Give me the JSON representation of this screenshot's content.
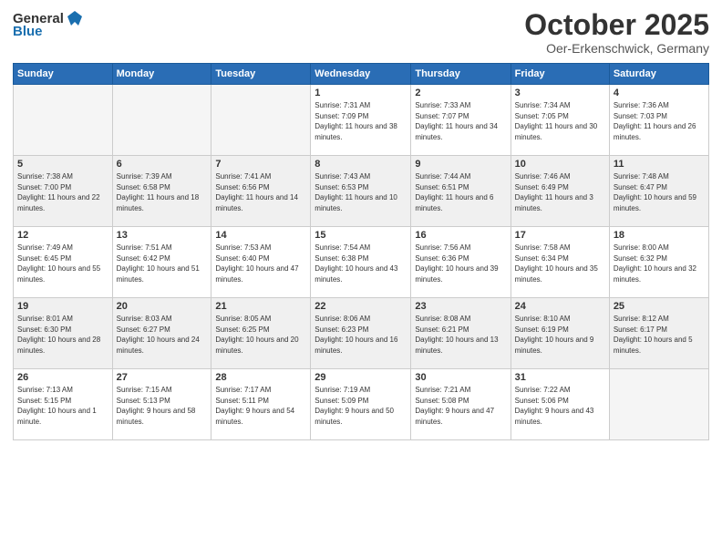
{
  "header": {
    "logo_general": "General",
    "logo_blue": "Blue",
    "month_title": "October 2025",
    "location": "Oer-Erkenschwick, Germany"
  },
  "days_of_week": [
    "Sunday",
    "Monday",
    "Tuesday",
    "Wednesday",
    "Thursday",
    "Friday",
    "Saturday"
  ],
  "weeks": [
    {
      "shaded": false,
      "days": [
        {
          "num": "",
          "sunrise": "",
          "sunset": "",
          "daylight": ""
        },
        {
          "num": "",
          "sunrise": "",
          "sunset": "",
          "daylight": ""
        },
        {
          "num": "",
          "sunrise": "",
          "sunset": "",
          "daylight": ""
        },
        {
          "num": "1",
          "sunrise": "Sunrise: 7:31 AM",
          "sunset": "Sunset: 7:09 PM",
          "daylight": "Daylight: 11 hours and 38 minutes."
        },
        {
          "num": "2",
          "sunrise": "Sunrise: 7:33 AM",
          "sunset": "Sunset: 7:07 PM",
          "daylight": "Daylight: 11 hours and 34 minutes."
        },
        {
          "num": "3",
          "sunrise": "Sunrise: 7:34 AM",
          "sunset": "Sunset: 7:05 PM",
          "daylight": "Daylight: 11 hours and 30 minutes."
        },
        {
          "num": "4",
          "sunrise": "Sunrise: 7:36 AM",
          "sunset": "Sunset: 7:03 PM",
          "daylight": "Daylight: 11 hours and 26 minutes."
        }
      ]
    },
    {
      "shaded": true,
      "days": [
        {
          "num": "5",
          "sunrise": "Sunrise: 7:38 AM",
          "sunset": "Sunset: 7:00 PM",
          "daylight": "Daylight: 11 hours and 22 minutes."
        },
        {
          "num": "6",
          "sunrise": "Sunrise: 7:39 AM",
          "sunset": "Sunset: 6:58 PM",
          "daylight": "Daylight: 11 hours and 18 minutes."
        },
        {
          "num": "7",
          "sunrise": "Sunrise: 7:41 AM",
          "sunset": "Sunset: 6:56 PM",
          "daylight": "Daylight: 11 hours and 14 minutes."
        },
        {
          "num": "8",
          "sunrise": "Sunrise: 7:43 AM",
          "sunset": "Sunset: 6:53 PM",
          "daylight": "Daylight: 11 hours and 10 minutes."
        },
        {
          "num": "9",
          "sunrise": "Sunrise: 7:44 AM",
          "sunset": "Sunset: 6:51 PM",
          "daylight": "Daylight: 11 hours and 6 minutes."
        },
        {
          "num": "10",
          "sunrise": "Sunrise: 7:46 AM",
          "sunset": "Sunset: 6:49 PM",
          "daylight": "Daylight: 11 hours and 3 minutes."
        },
        {
          "num": "11",
          "sunrise": "Sunrise: 7:48 AM",
          "sunset": "Sunset: 6:47 PM",
          "daylight": "Daylight: 10 hours and 59 minutes."
        }
      ]
    },
    {
      "shaded": false,
      "days": [
        {
          "num": "12",
          "sunrise": "Sunrise: 7:49 AM",
          "sunset": "Sunset: 6:45 PM",
          "daylight": "Daylight: 10 hours and 55 minutes."
        },
        {
          "num": "13",
          "sunrise": "Sunrise: 7:51 AM",
          "sunset": "Sunset: 6:42 PM",
          "daylight": "Daylight: 10 hours and 51 minutes."
        },
        {
          "num": "14",
          "sunrise": "Sunrise: 7:53 AM",
          "sunset": "Sunset: 6:40 PM",
          "daylight": "Daylight: 10 hours and 47 minutes."
        },
        {
          "num": "15",
          "sunrise": "Sunrise: 7:54 AM",
          "sunset": "Sunset: 6:38 PM",
          "daylight": "Daylight: 10 hours and 43 minutes."
        },
        {
          "num": "16",
          "sunrise": "Sunrise: 7:56 AM",
          "sunset": "Sunset: 6:36 PM",
          "daylight": "Daylight: 10 hours and 39 minutes."
        },
        {
          "num": "17",
          "sunrise": "Sunrise: 7:58 AM",
          "sunset": "Sunset: 6:34 PM",
          "daylight": "Daylight: 10 hours and 35 minutes."
        },
        {
          "num": "18",
          "sunrise": "Sunrise: 8:00 AM",
          "sunset": "Sunset: 6:32 PM",
          "daylight": "Daylight: 10 hours and 32 minutes."
        }
      ]
    },
    {
      "shaded": true,
      "days": [
        {
          "num": "19",
          "sunrise": "Sunrise: 8:01 AM",
          "sunset": "Sunset: 6:30 PM",
          "daylight": "Daylight: 10 hours and 28 minutes."
        },
        {
          "num": "20",
          "sunrise": "Sunrise: 8:03 AM",
          "sunset": "Sunset: 6:27 PM",
          "daylight": "Daylight: 10 hours and 24 minutes."
        },
        {
          "num": "21",
          "sunrise": "Sunrise: 8:05 AM",
          "sunset": "Sunset: 6:25 PM",
          "daylight": "Daylight: 10 hours and 20 minutes."
        },
        {
          "num": "22",
          "sunrise": "Sunrise: 8:06 AM",
          "sunset": "Sunset: 6:23 PM",
          "daylight": "Daylight: 10 hours and 16 minutes."
        },
        {
          "num": "23",
          "sunrise": "Sunrise: 8:08 AM",
          "sunset": "Sunset: 6:21 PM",
          "daylight": "Daylight: 10 hours and 13 minutes."
        },
        {
          "num": "24",
          "sunrise": "Sunrise: 8:10 AM",
          "sunset": "Sunset: 6:19 PM",
          "daylight": "Daylight: 10 hours and 9 minutes."
        },
        {
          "num": "25",
          "sunrise": "Sunrise: 8:12 AM",
          "sunset": "Sunset: 6:17 PM",
          "daylight": "Daylight: 10 hours and 5 minutes."
        }
      ]
    },
    {
      "shaded": false,
      "days": [
        {
          "num": "26",
          "sunrise": "Sunrise: 7:13 AM",
          "sunset": "Sunset: 5:15 PM",
          "daylight": "Daylight: 10 hours and 1 minute."
        },
        {
          "num": "27",
          "sunrise": "Sunrise: 7:15 AM",
          "sunset": "Sunset: 5:13 PM",
          "daylight": "Daylight: 9 hours and 58 minutes."
        },
        {
          "num": "28",
          "sunrise": "Sunrise: 7:17 AM",
          "sunset": "Sunset: 5:11 PM",
          "daylight": "Daylight: 9 hours and 54 minutes."
        },
        {
          "num": "29",
          "sunrise": "Sunrise: 7:19 AM",
          "sunset": "Sunset: 5:09 PM",
          "daylight": "Daylight: 9 hours and 50 minutes."
        },
        {
          "num": "30",
          "sunrise": "Sunrise: 7:21 AM",
          "sunset": "Sunset: 5:08 PM",
          "daylight": "Daylight: 9 hours and 47 minutes."
        },
        {
          "num": "31",
          "sunrise": "Sunrise: 7:22 AM",
          "sunset": "Sunset: 5:06 PM",
          "daylight": "Daylight: 9 hours and 43 minutes."
        },
        {
          "num": "",
          "sunrise": "",
          "sunset": "",
          "daylight": ""
        }
      ]
    }
  ]
}
